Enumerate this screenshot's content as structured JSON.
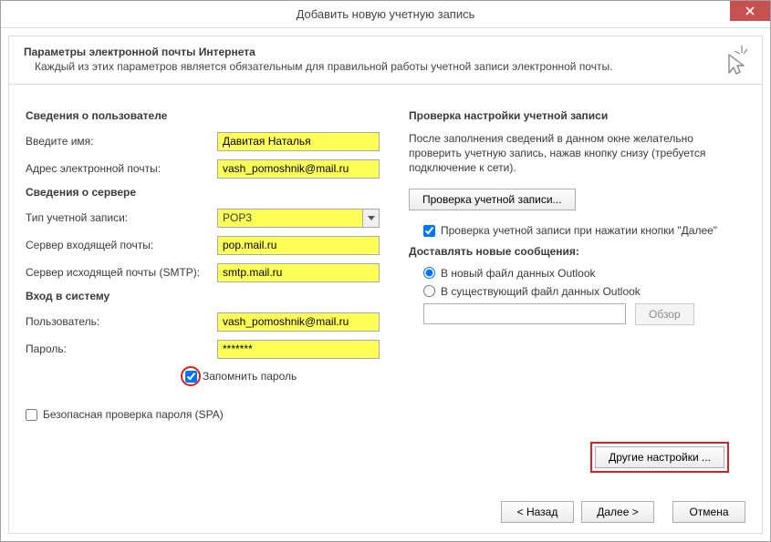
{
  "window": {
    "title": "Добавить новую учетную запись"
  },
  "header": {
    "heading": "Параметры электронной почты Интернета",
    "subheading": "Каждый из этих параметров является обязательным для правильной работы учетной записи электронной почты."
  },
  "left": {
    "section_user": "Сведения о пользователе",
    "name_label": "Введите имя:",
    "name_value": "Давитая Наталья",
    "email_label": "Адрес электронной почты:",
    "email_value": "vash_pomoshnik@mail.ru",
    "section_server": "Сведения о сервере",
    "account_type_label": "Тип учетной записи:",
    "account_type_value": "POP3",
    "incoming_label": "Сервер входящей почты:",
    "incoming_value": "pop.mail.ru",
    "outgoing_label": "Сервер исходящей почты (SMTP):",
    "outgoing_value": "smtp.mail.ru",
    "section_login": "Вход в систему",
    "user_label": "Пользователь:",
    "user_value": "vash_pomoshnik@mail.ru",
    "password_label": "Пароль:",
    "password_value": "*******",
    "remember_label": "Запомнить пароль",
    "spa_label": "Безопасная проверка пароля (SPA)"
  },
  "right": {
    "section_test": "Проверка настройки учетной записи",
    "test_info": "После заполнения сведений в данном окне желательно проверить учетную запись, нажав кнопку снизу (требуется подключение к сети).",
    "test_button": "Проверка учетной записи...",
    "auto_test_label": "Проверка учетной записи при нажатии кнопки \"Далее\"",
    "section_deliver": "Доставлять новые сообщения:",
    "radio_new": "В новый файл данных Outlook",
    "radio_existing": "В существующий файл данных Outlook",
    "browse_button": "Обзор",
    "more_settings": "Другие настройки ..."
  },
  "footer": {
    "back": "< Назад",
    "next": "Далее >",
    "cancel": "Отмена"
  }
}
